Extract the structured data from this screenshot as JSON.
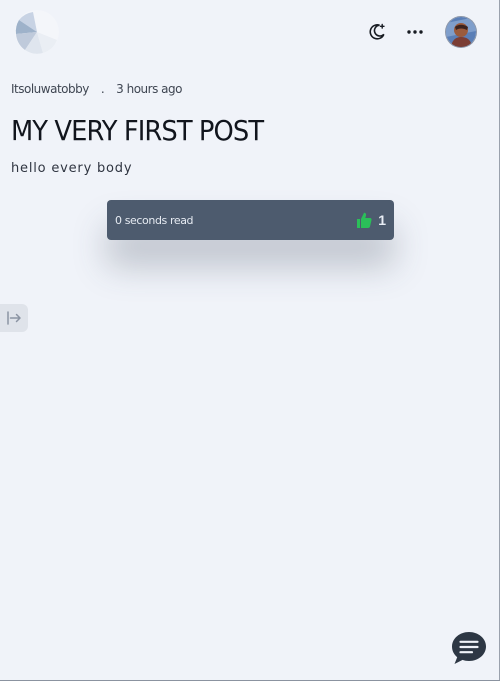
{
  "header": {
    "logo": "app-logo",
    "actions": {
      "theme_toggle_icon": "moon-icon",
      "more_icon": "more-horizontal-icon",
      "avatar": "user-avatar"
    }
  },
  "post": {
    "author": "Itsoluwatobby",
    "separator": ".",
    "timestamp": "3 hours ago",
    "title": "MY VERY FIRST POST",
    "body": "hello every body",
    "read_time": "0 seconds read",
    "likes": "1",
    "like_icon": "thumbs-up-icon"
  },
  "sidebar_toggle": {
    "icon": "arrow-right-to-line-icon"
  },
  "chat": {
    "icon": "chat-icon"
  },
  "colors": {
    "background": "#f0f3f9",
    "card": "#4d5b6e",
    "like_accent": "#2bbf59",
    "chat_button": "#2d3744"
  }
}
